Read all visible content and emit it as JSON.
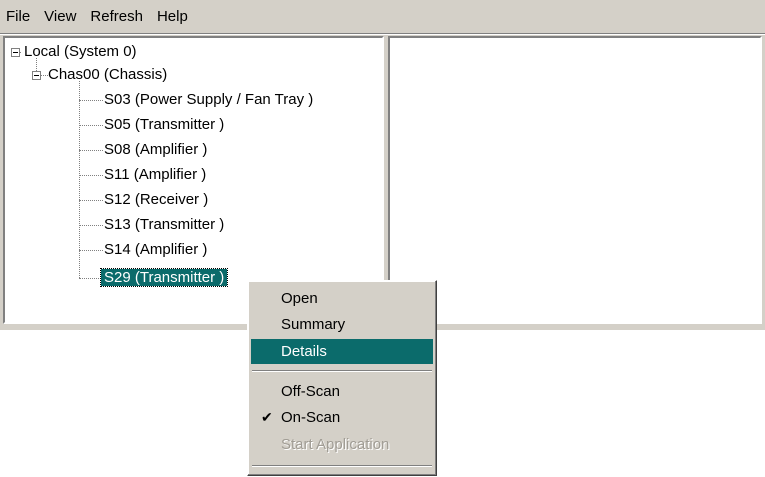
{
  "menubar": {
    "items": [
      "File",
      "View",
      "Refresh",
      "Help"
    ]
  },
  "tree": {
    "root": "Local (System 0)",
    "chassis": "Chas00 (Chassis)",
    "slots": [
      "S03 (Power Supply / Fan Tray )",
      "S05 (Transmitter )",
      "S08 (Amplifier )",
      "S11 (Amplifier )",
      "S12 (Receiver )",
      "S13 (Transmitter )",
      "S14 (Amplifier )",
      "S29 (Transmitter )"
    ],
    "selected_slot": "S29 (Transmitter )"
  },
  "context_menu": {
    "items": [
      "Open",
      "Summary",
      "Details",
      "Off-Scan",
      "On-Scan",
      "Start Application"
    ],
    "highlighted": "Details",
    "checked": "On-Scan",
    "disabled": "Start Application",
    "check_glyph": "✔"
  },
  "colors": {
    "selection": "#0b6b6b",
    "window_face": "#d4d0c8"
  }
}
